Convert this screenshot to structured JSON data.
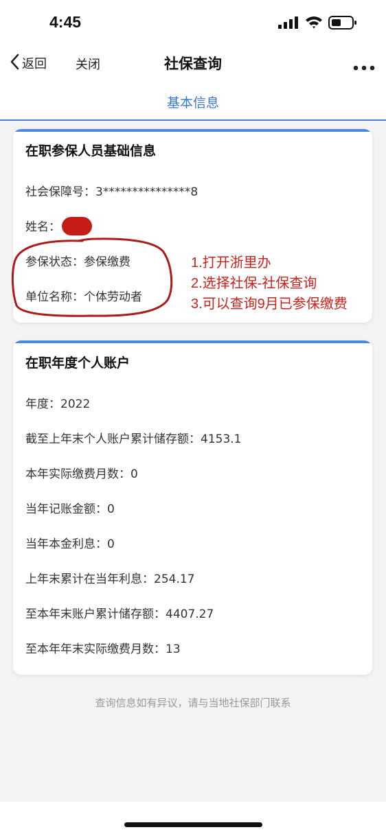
{
  "status_bar": {
    "time": "4:45",
    "icons": [
      "cellular-signal-icon",
      "wifi-icon",
      "battery-icon"
    ]
  },
  "nav": {
    "back_label": "返回",
    "close_label": "关闭",
    "title": "社保查询",
    "more_icon": "more-dots-icon"
  },
  "tab": {
    "label": "基本信息",
    "color": "#3a78d0"
  },
  "card1": {
    "title": "在职参保人员基础信息",
    "rows": [
      "社会保障号：3***************8",
      "姓名：",
      "参保状态：参保缴费",
      "单位名称：个体劳动者"
    ]
  },
  "annotation": {
    "color": "#c8221c",
    "lines": [
      "1.打开浙里办",
      "2.选择社保-社保查询",
      "3.可以查询9月已参保缴费"
    ]
  },
  "card2": {
    "title": "在职年度个人账户",
    "rows": [
      "年度：2022",
      "截至上年末个人账户累计储存额：4153.1",
      "本年实际缴费月数：0",
      "当年记账金额：0",
      "当年本金利息：0",
      "上年末累计在当年利息：254.17",
      "至本年末账户累计储存额：4407.27",
      "至本年年末实际缴费月数：13"
    ]
  },
  "footer": {
    "note": "查询信息如有异议，请与当地社保部门联系"
  },
  "theme": {
    "accent": "#4a86e4",
    "redact": "#c41c17"
  }
}
